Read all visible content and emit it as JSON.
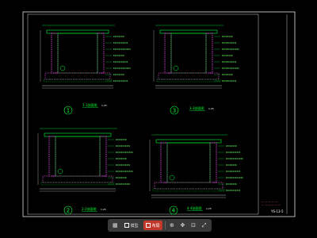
{
  "drawing": {
    "details": [
      {
        "number": "1",
        "title": "1-1剖面图",
        "scale": "1:25"
      },
      {
        "number": "2",
        "title": "2-2剖面图",
        "scale": "1:25"
      },
      {
        "number": "3",
        "title": "3-3剖面图",
        "scale": "1:25"
      },
      {
        "number": "4",
        "title": "4-4剖面图",
        "scale": "1:25"
      }
    ],
    "title_block": {
      "code": "YS-13-5"
    },
    "colors": {
      "frame": "#ffffff",
      "line": "#00ff33",
      "wall": "#cc44cc",
      "text": "#66ff66",
      "dim": "#ffffff"
    }
  },
  "toolbar": {
    "tab_model": "模型",
    "tab_layout": "布局",
    "icons": [
      "grid-icon",
      "model-icon",
      "layout-icon",
      "zoom-icon",
      "pan-icon",
      "fit-icon",
      "fullscreen-icon"
    ]
  }
}
